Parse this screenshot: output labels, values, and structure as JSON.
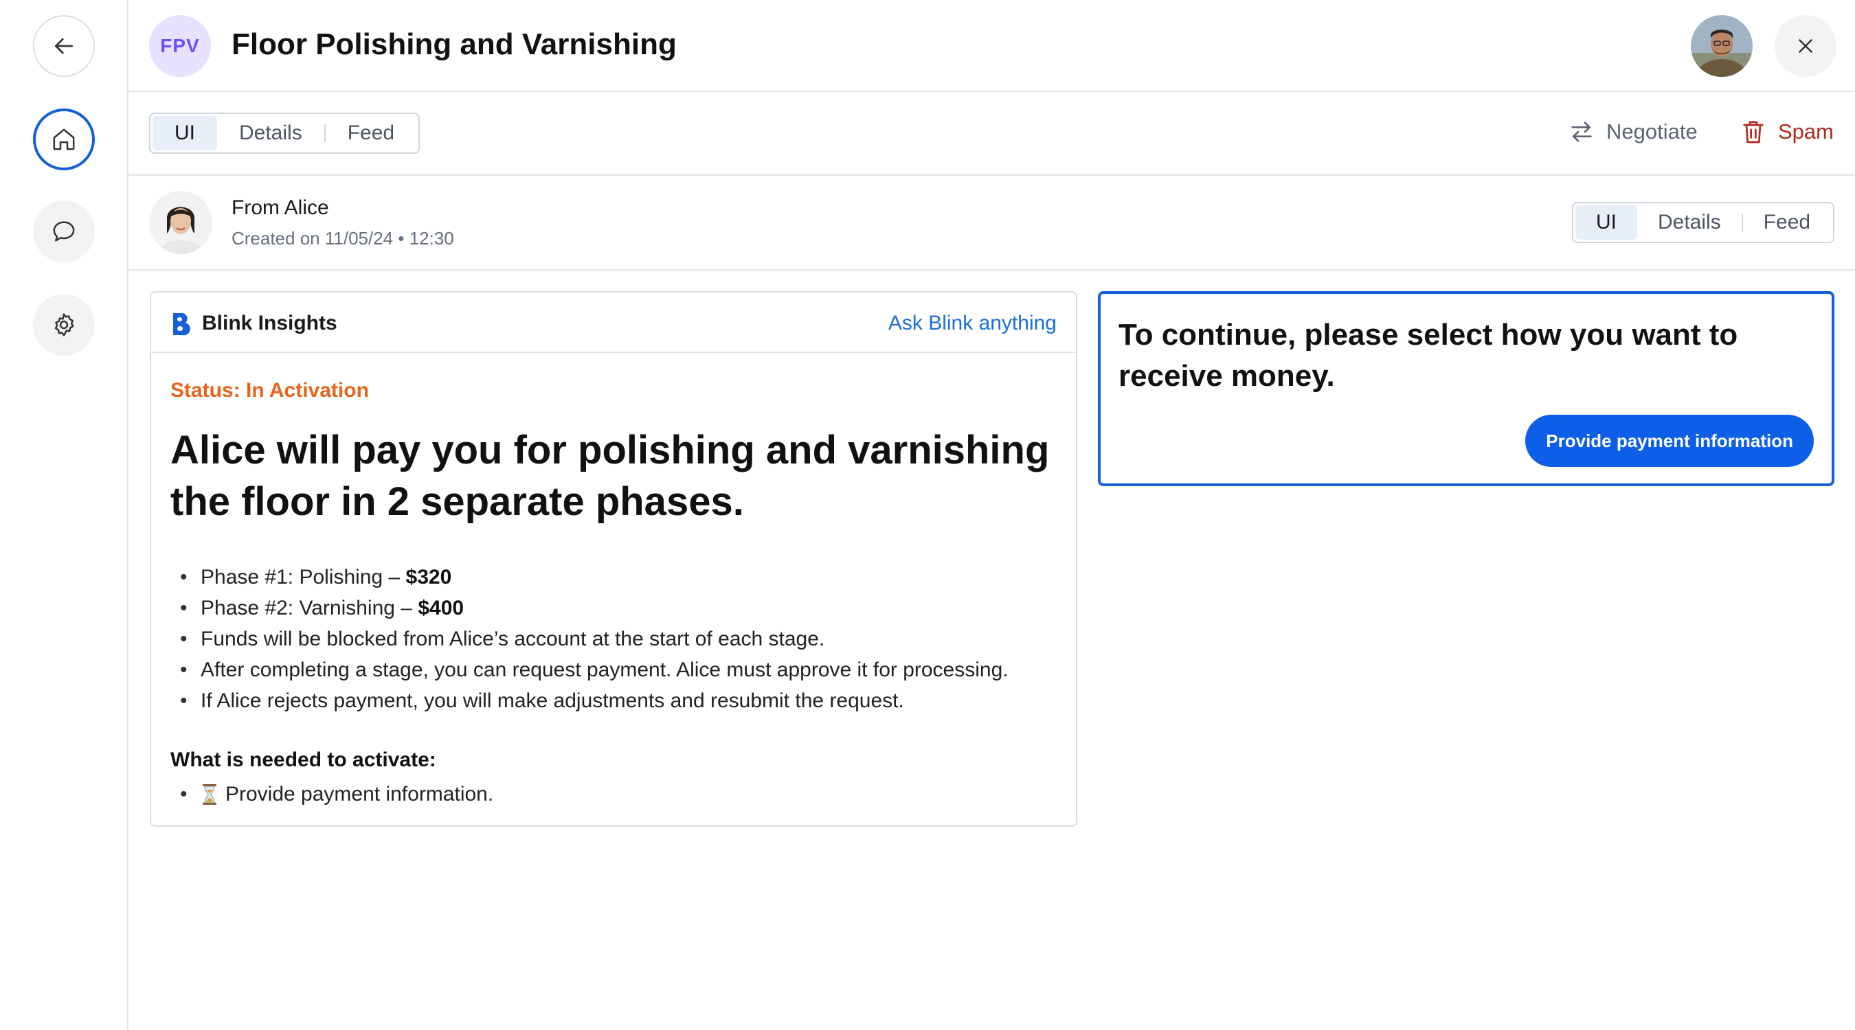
{
  "colors": {
    "accent": "#1660d6",
    "status_orange": "#e8641b",
    "spam_red": "#b3281e",
    "badge_bg": "#e6e1ff",
    "badge_fg": "#6b52f0"
  },
  "rail": {
    "icons": [
      "back-arrow-icon",
      "home-icon",
      "chat-icon",
      "gear-icon"
    ]
  },
  "header": {
    "badge": "FPV",
    "title": "Floor Polishing and Varnishing"
  },
  "tabs_top": [
    "UI",
    "Details",
    "Feed"
  ],
  "toolbar": {
    "negotiate": "Negotiate",
    "spam": "Spam"
  },
  "from": {
    "name": "From Alice",
    "created": "Created on 11/05/24 • 12:30"
  },
  "tabs_right": [
    "UI",
    "Details",
    "Feed"
  ],
  "insights": {
    "title": "Blink Insights",
    "ask": "Ask Blink anything",
    "status": "Status: In Activation",
    "headline": "Alice will pay you for polishing and varnishing the floor in 2 separate phases.",
    "phase1_label": "Phase #1: Polishing – ",
    "phase1_amount": "$320",
    "phase2_label": "Phase #2: Varnishing – ",
    "phase2_amount": "$400",
    "bullet3": "Funds will be blocked from Alice’s account at the start of each stage.",
    "bullet4": "After completing a stage, you can request payment. Alice must approve it for processing.",
    "bullet5": "If Alice rejects payment, you will make adjustments and resubmit the request.",
    "needed_title": "What is needed to activate:",
    "needed_item": "Provide payment information."
  },
  "payment": {
    "prompt": "To continue, please select how you want to receive money.",
    "button": "Provide payment information"
  }
}
